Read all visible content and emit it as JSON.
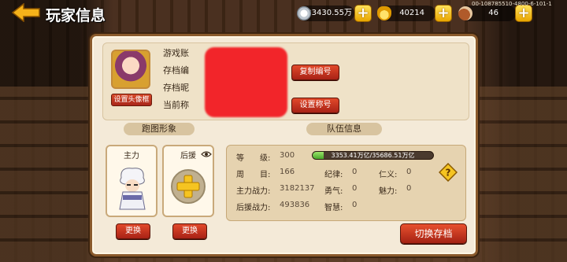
{
  "header": {
    "title": "玩家信息",
    "uid": "00-108785510-4800-6-101-1"
  },
  "resources": [
    {
      "name": "silver-coin",
      "value": "33430.55万"
    },
    {
      "name": "gold-ingot",
      "value": "40214"
    },
    {
      "name": "drumstick",
      "value": "46"
    }
  ],
  "profile": {
    "set_avatar_frame": "设置头像框",
    "labels": [
      "游戏账",
      "存档编",
      "存档昵",
      "当前称"
    ],
    "copy_id_button": "复制编号",
    "set_title_button": "设置称号"
  },
  "run_image": {
    "header": "跑图形象",
    "main_label": "主力",
    "support_label": "后援",
    "change_button": "更换"
  },
  "team_info": {
    "header": "队伍信息",
    "level_label": "等　　级:",
    "level_value": "300",
    "exp_text": "3353.41万亿/35686.51万亿",
    "exp_fraction": 0.094,
    "zhoumu_label": "周　　目:",
    "zhoumu_value": "166",
    "jilv_label": "纪律:",
    "jilv_value": "0",
    "renyi_label": "仁义:",
    "renyi_value": "0",
    "main_power_label": "主力战力:",
    "main_power_value": "3182137",
    "yongqi_label": "勇气:",
    "yongqi_value": "0",
    "meili_label": "魅力:",
    "meili_value": "0",
    "support_power_label": "后援战力:",
    "support_power_value": "493836",
    "zhihui_label": "智慧:",
    "zhihui_value": "0"
  },
  "switch_save_button": "切换存档",
  "colors": {
    "accent_red": "#c8321e",
    "gold": "#f0b400",
    "panel": "#f4ead8"
  }
}
